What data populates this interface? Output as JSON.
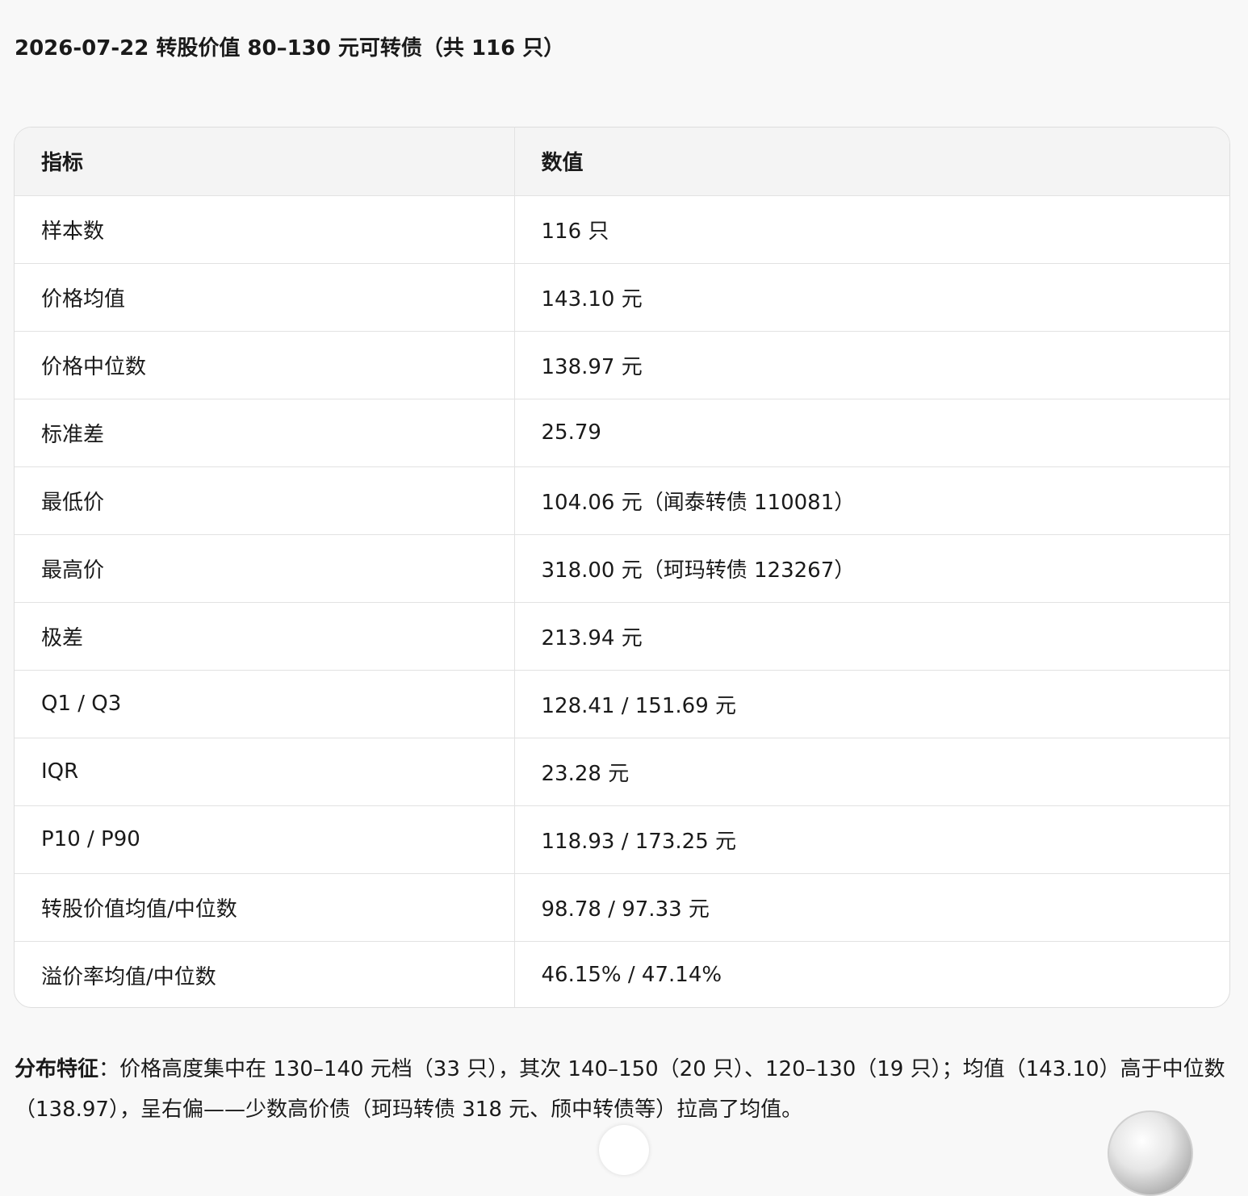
{
  "heading": "2026-07-22 转股价值 80–130 元可转债（共 116 只）",
  "table": {
    "headers": [
      "指标",
      "数值"
    ],
    "rows": [
      {
        "label": "样本数",
        "value": "116 只"
      },
      {
        "label": "价格均值",
        "value": "143.10 元"
      },
      {
        "label": "价格中位数",
        "value": "138.97 元"
      },
      {
        "label": "标准差",
        "value": "25.79"
      },
      {
        "label": "最低价",
        "value": "104.06 元（闻泰转债 110081）"
      },
      {
        "label": "最高价",
        "value": "318.00 元（珂玛转债 123267）"
      },
      {
        "label": "极差",
        "value": "213.94 元"
      },
      {
        "label": "Q1 / Q3",
        "value": "128.41 / 151.69 元"
      },
      {
        "label": "IQR",
        "value": "23.28 元"
      },
      {
        "label": "P10 / P90",
        "value": "118.93 / 173.25 元"
      },
      {
        "label": "转股价值均值/中位数",
        "value": "98.78 / 97.33 元"
      },
      {
        "label": "溢价率均值/中位数",
        "value": "46.15% / 47.14%"
      }
    ]
  },
  "summary": {
    "lead": "分布特征",
    "text": "：价格高度集中在 130–140 元档（33 只），其次 140–150（20 只）、120–130（19 只）；均值（143.10）高于中位数（138.97），呈右偏——少数高价债（珂玛转债 318 元、颀中转债等）拉高了均值。"
  }
}
